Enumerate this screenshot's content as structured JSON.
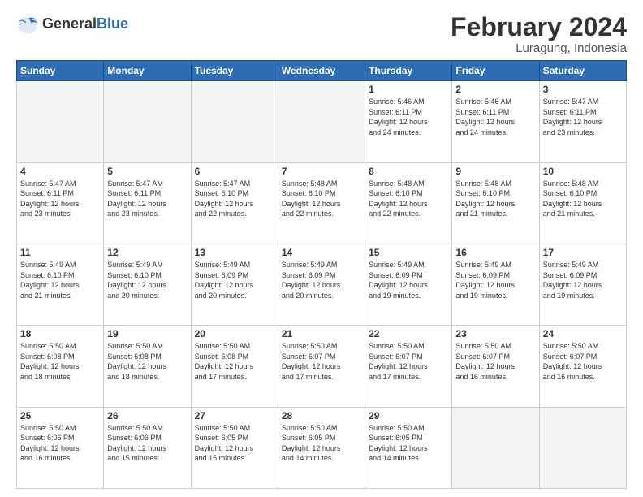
{
  "header": {
    "logo_general": "General",
    "logo_blue": "Blue",
    "month": "February 2024",
    "location": "Luragung, Indonesia"
  },
  "weekdays": [
    "Sunday",
    "Monday",
    "Tuesday",
    "Wednesday",
    "Thursday",
    "Friday",
    "Saturday"
  ],
  "weeks": [
    [
      {
        "day": "",
        "info": ""
      },
      {
        "day": "",
        "info": ""
      },
      {
        "day": "",
        "info": ""
      },
      {
        "day": "",
        "info": ""
      },
      {
        "day": "1",
        "info": "Sunrise: 5:46 AM\nSunset: 6:11 PM\nDaylight: 12 hours\nand 24 minutes."
      },
      {
        "day": "2",
        "info": "Sunrise: 5:46 AM\nSunset: 6:11 PM\nDaylight: 12 hours\nand 24 minutes."
      },
      {
        "day": "3",
        "info": "Sunrise: 5:47 AM\nSunset: 6:11 PM\nDaylight: 12 hours\nand 23 minutes."
      }
    ],
    [
      {
        "day": "4",
        "info": "Sunrise: 5:47 AM\nSunset: 6:11 PM\nDaylight: 12 hours\nand 23 minutes."
      },
      {
        "day": "5",
        "info": "Sunrise: 5:47 AM\nSunset: 6:11 PM\nDaylight: 12 hours\nand 23 minutes."
      },
      {
        "day": "6",
        "info": "Sunrise: 5:47 AM\nSunset: 6:10 PM\nDaylight: 12 hours\nand 22 minutes."
      },
      {
        "day": "7",
        "info": "Sunrise: 5:48 AM\nSunset: 6:10 PM\nDaylight: 12 hours\nand 22 minutes."
      },
      {
        "day": "8",
        "info": "Sunrise: 5:48 AM\nSunset: 6:10 PM\nDaylight: 12 hours\nand 22 minutes."
      },
      {
        "day": "9",
        "info": "Sunrise: 5:48 AM\nSunset: 6:10 PM\nDaylight: 12 hours\nand 21 minutes."
      },
      {
        "day": "10",
        "info": "Sunrise: 5:48 AM\nSunset: 6:10 PM\nDaylight: 12 hours\nand 21 minutes."
      }
    ],
    [
      {
        "day": "11",
        "info": "Sunrise: 5:49 AM\nSunset: 6:10 PM\nDaylight: 12 hours\nand 21 minutes."
      },
      {
        "day": "12",
        "info": "Sunrise: 5:49 AM\nSunset: 6:10 PM\nDaylight: 12 hours\nand 20 minutes."
      },
      {
        "day": "13",
        "info": "Sunrise: 5:49 AM\nSunset: 6:09 PM\nDaylight: 12 hours\nand 20 minutes."
      },
      {
        "day": "14",
        "info": "Sunrise: 5:49 AM\nSunset: 6:09 PM\nDaylight: 12 hours\nand 20 minutes."
      },
      {
        "day": "15",
        "info": "Sunrise: 5:49 AM\nSunset: 6:09 PM\nDaylight: 12 hours\nand 19 minutes."
      },
      {
        "day": "16",
        "info": "Sunrise: 5:49 AM\nSunset: 6:09 PM\nDaylight: 12 hours\nand 19 minutes."
      },
      {
        "day": "17",
        "info": "Sunrise: 5:49 AM\nSunset: 6:09 PM\nDaylight: 12 hours\nand 19 minutes."
      }
    ],
    [
      {
        "day": "18",
        "info": "Sunrise: 5:50 AM\nSunset: 6:08 PM\nDaylight: 12 hours\nand 18 minutes."
      },
      {
        "day": "19",
        "info": "Sunrise: 5:50 AM\nSunset: 6:08 PM\nDaylight: 12 hours\nand 18 minutes."
      },
      {
        "day": "20",
        "info": "Sunrise: 5:50 AM\nSunset: 6:08 PM\nDaylight: 12 hours\nand 17 minutes."
      },
      {
        "day": "21",
        "info": "Sunrise: 5:50 AM\nSunset: 6:07 PM\nDaylight: 12 hours\nand 17 minutes."
      },
      {
        "day": "22",
        "info": "Sunrise: 5:50 AM\nSunset: 6:07 PM\nDaylight: 12 hours\nand 17 minutes."
      },
      {
        "day": "23",
        "info": "Sunrise: 5:50 AM\nSunset: 6:07 PM\nDaylight: 12 hours\nand 16 minutes."
      },
      {
        "day": "24",
        "info": "Sunrise: 5:50 AM\nSunset: 6:07 PM\nDaylight: 12 hours\nand 16 minutes."
      }
    ],
    [
      {
        "day": "25",
        "info": "Sunrise: 5:50 AM\nSunset: 6:06 PM\nDaylight: 12 hours\nand 16 minutes."
      },
      {
        "day": "26",
        "info": "Sunrise: 5:50 AM\nSunset: 6:06 PM\nDaylight: 12 hours\nand 15 minutes."
      },
      {
        "day": "27",
        "info": "Sunrise: 5:50 AM\nSunset: 6:05 PM\nDaylight: 12 hours\nand 15 minutes."
      },
      {
        "day": "28",
        "info": "Sunrise: 5:50 AM\nSunset: 6:05 PM\nDaylight: 12 hours\nand 14 minutes."
      },
      {
        "day": "29",
        "info": "Sunrise: 5:50 AM\nSunset: 6:05 PM\nDaylight: 12 hours\nand 14 minutes."
      },
      {
        "day": "",
        "info": ""
      },
      {
        "day": "",
        "info": ""
      }
    ]
  ]
}
